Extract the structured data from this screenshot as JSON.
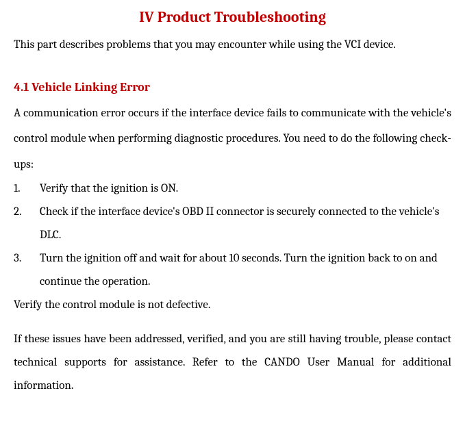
{
  "title": "IV Product Troubleshooting",
  "intro": "This part describes problems that you may encounter while using the VCI device.",
  "section": {
    "heading": "4.1 Vehicle Linking Error",
    "body": "A communication error occurs if the interface device fails to communicate with  the  vehicle's control  module  when performing diagnostic  procedures. You   need to do the following check-ups:",
    "items": [
      {
        "num": "1.",
        "text": "Verify that the ignition is ON."
      },
      {
        "num": "2.",
        "text": "Check if the interface device's OBD II connector is securely connected to the vehicle's DLC."
      },
      {
        "num": "3.",
        "text": "Turn the ignition off and wait for about 10 seconds. Turn the ignition back  to on and continue the operation."
      }
    ],
    "after_list": "Verify the control module is not defective.",
    "closing": "If these issues have been addressed, verified, and you are still having trouble, please contact technical supports for assistance. Refer to the CANDO User Manual for additional information."
  }
}
